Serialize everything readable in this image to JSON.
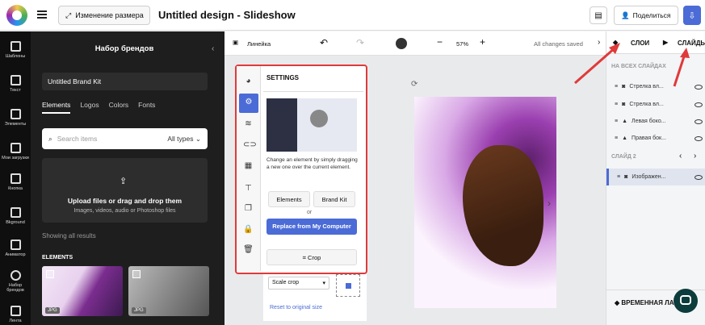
{
  "topbar": {
    "resize_label": "Изменение размера",
    "title": "Untitled design - Slideshow",
    "share_label": "Поделиться"
  },
  "rail": {
    "items": [
      "Шаблоны",
      "Текст",
      "Элементы",
      "Мои загрузки",
      "Кнопка",
      "Bkground",
      "Аниматор",
      "Набор брендов",
      "Лента"
    ]
  },
  "brand_panel": {
    "title": "Набор брендов",
    "kit_name": "Untitled Brand Kit",
    "tabs": [
      "Elements",
      "Logos",
      "Colors",
      "Fonts"
    ],
    "search_placeholder": "Search items",
    "type_filter": "All types",
    "upload_title": "Upload files or drag and drop them",
    "upload_subtitle": "Images, videos, audio or Photoshop files",
    "showing": "Showing all results",
    "elements_label": "ELEMENTS",
    "thumbs": [
      "JPG",
      "JPG"
    ]
  },
  "toolbar": {
    "ruler": "Линейка",
    "zoom": "57%",
    "saved": "All changes saved"
  },
  "settings": {
    "title": "SETTINGS",
    "description": "Change an element by simply dragging a new one over the current element.",
    "elements_btn": "Elements",
    "brandkit_btn": "Brand Kit",
    "or": "or",
    "replace_btn": "Replace from My Computer",
    "crop_btn": "Crop",
    "scale_crop": "Scale crop",
    "reset": "Reset to original size"
  },
  "right_panel": {
    "tab_layers": "СЛОИ",
    "tab_slides": "СЛАЙДЫ",
    "section_all": "НА ВСЕХ СЛАЙДАХ",
    "layers": [
      "Стрелка вл...",
      "Стрелка вл...",
      "Левая боко...",
      "Правая бок..."
    ],
    "slide2": "СЛАЙД 2",
    "slide2_layer": "Изображен...",
    "timeline": "ВРЕМЕННАЯ ЛА"
  },
  "colors": {
    "accent": "#4b6bd6",
    "highlight": "#e03a3a"
  }
}
